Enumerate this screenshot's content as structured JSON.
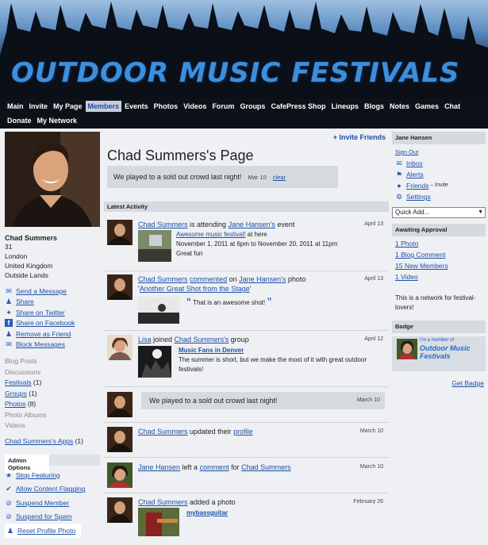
{
  "site": {
    "title": "OUTDOOR MUSIC FESTIVALS"
  },
  "nav": {
    "row1": [
      "Main",
      "Invite",
      "My Page",
      "Members",
      "Events",
      "Photos",
      "Videos",
      "Forum",
      "Groups",
      "CafePress Shop",
      "Lineups",
      "Blogs",
      "Notes",
      "Games",
      "Chat"
    ],
    "row2": [
      "Donate",
      "My Network"
    ],
    "active": "Members"
  },
  "profile": {
    "name": "Chad Summers",
    "age": "31",
    "city": "London",
    "country": "United Kingdom",
    "region": "Outside Lands",
    "actions": [
      {
        "label": "Send a Message",
        "icon": "envelope-icon"
      },
      {
        "label": "Share",
        "icon": "person-plus-icon"
      },
      {
        "label": "Share on Twitter",
        "icon": "twitter-icon"
      },
      {
        "label": "Share on Facebook",
        "icon": "facebook-icon"
      },
      {
        "label": "Remove as Friend",
        "icon": "person-minus-icon"
      },
      {
        "label": "Block Messages",
        "icon": "block-messages-icon"
      }
    ],
    "sections": {
      "blog_posts": "Blog Posts",
      "discussions": "Discussions",
      "festivals": "Festivals",
      "festivals_count": "(1)",
      "groups": "Groups",
      "groups_count": "(1)",
      "photos": "Photos",
      "photos_count": "(8)",
      "photo_albums": "Photo Albums",
      "videos": "Videos",
      "apps": "Chad Summers's Apps",
      "apps_count": "(1)"
    }
  },
  "admin": {
    "title": "Admin Options",
    "options": [
      {
        "label": "Stop Featuring",
        "icon": "star-icon"
      },
      {
        "label": "Allow Content Flagging",
        "icon": "checkmark-icon"
      },
      {
        "label": "Suspend Member",
        "icon": "suspend-icon"
      },
      {
        "label": "Suspend for Spam",
        "icon": "spam-suspend-icon"
      },
      {
        "label": "Reset Profile Photo",
        "icon": "person-icon"
      }
    ]
  },
  "page": {
    "invite_label": "Invite Friends",
    "title": "Chad Summers's Page",
    "status": "We played to a sold out crowd last night!",
    "status_date": "Mar 10",
    "clear_label": "clear",
    "latest_activity": "Latest Activity"
  },
  "feed": {
    "item1": {
      "actor": "Chad Summers",
      "verb": " is attending ",
      "target": "Jane Hansen's",
      "tail": " event",
      "date": "April 13",
      "event_name": "Awesome music festival!",
      "event_loc": " at here",
      "event_time": "November 1, 2011 at 6pm to November 20, 2011 at 11pm",
      "event_desc": "Great fun"
    },
    "item2": {
      "actor": "Chad Summers",
      "verb": "commented",
      "mid": " on ",
      "target": "Jane Hansen's",
      "tail": " photo '",
      "photo": "Another Great Shot from the Stage",
      "close": "'",
      "date": "April 13",
      "quote": "That is an awesome shot!"
    },
    "item3": {
      "actor": "Lisa",
      "verb": " joined ",
      "target": "Chad Summers's",
      "tail": " group",
      "date": "April 12",
      "group_name": "Music Fans in Denver",
      "group_desc": "The summer is short, but we make the most of it with great outdoor festivals!"
    },
    "item4": {
      "status": "We played to a sold out crowd last night!",
      "date": "March 10"
    },
    "item5": {
      "actor": "Chad Summers",
      "verb": " updated their ",
      "target": "profile",
      "date": "March 10"
    },
    "item6": {
      "actor": "Jane Hansen",
      "verb": " left a ",
      "target": "comment",
      "mid": " for ",
      "target2": "Chad Summers",
      "date": "March 10"
    },
    "item7": {
      "actor": "Chad Summers",
      "verb": " added a photo",
      "date": "February 26",
      "photo_name": "mybassguitar"
    }
  },
  "sidebar": {
    "user": "Jane Hansen",
    "sign_out": "Sign Out",
    "inbox": "Inbox",
    "alerts": "Alerts",
    "friends": "Friends",
    "friends_invite": "– Invite",
    "settings": "Settings",
    "quick_add": "Quick Add...",
    "awaiting_title": "Awaiting Approval",
    "awaiting": [
      "1 Photo",
      "1 Blog Comment",
      "15 New Members",
      "1 Video"
    ],
    "network_desc": "This is a network for festival-lovers!",
    "badge_title": "Badge",
    "badge_caption": "I'm a member of",
    "badge_name": "Outdoor Music Festivals",
    "get_badge": "Get Badge"
  },
  "colors": {
    "link": "#1e4fa6",
    "nav_bg": "#0d1218",
    "panel": "#d6dae0",
    "title_blue": "#3d8fdc"
  }
}
